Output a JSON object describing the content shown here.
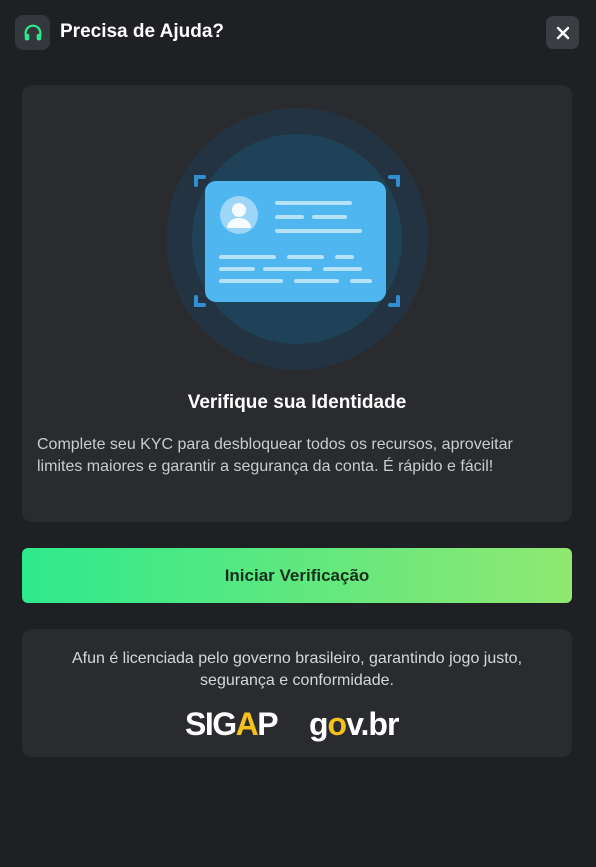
{
  "header": {
    "title": "Precisa de Ajuda?",
    "support_icon": "headset-icon",
    "close_icon": "close-icon",
    "close_glyph": "✕"
  },
  "kyc_card": {
    "illustration_icon": "id-card-icon",
    "title": "Verifique sua Identidade",
    "description": "Complete seu KYC para desbloquear todos os recursos, aproveitar limites maiores e garantir a segurança da conta. É rápido e fácil!"
  },
  "cta": {
    "label": "Iniciar Verificação"
  },
  "footer": {
    "text": "Afun é licenciada pelo governo brasileiro, garantindo jogo justo, segurança e conformidade.",
    "logos": {
      "sigap_pre": "SIG",
      "sigap_mid": "A",
      "sigap_post": "P",
      "govbr_pre": "g",
      "govbr_o": "o",
      "govbr_post": "v.br"
    }
  },
  "colors": {
    "background": "#1f2023",
    "card": "#2a2b2f",
    "accent_green": "#2ee98c",
    "accent_lime": "#90e872",
    "id_blue": "#4fb6f0",
    "sigap_yellow": "#f5c21b",
    "govbr_blue": "#1d5fd6",
    "govbr_green": "#28a745"
  }
}
